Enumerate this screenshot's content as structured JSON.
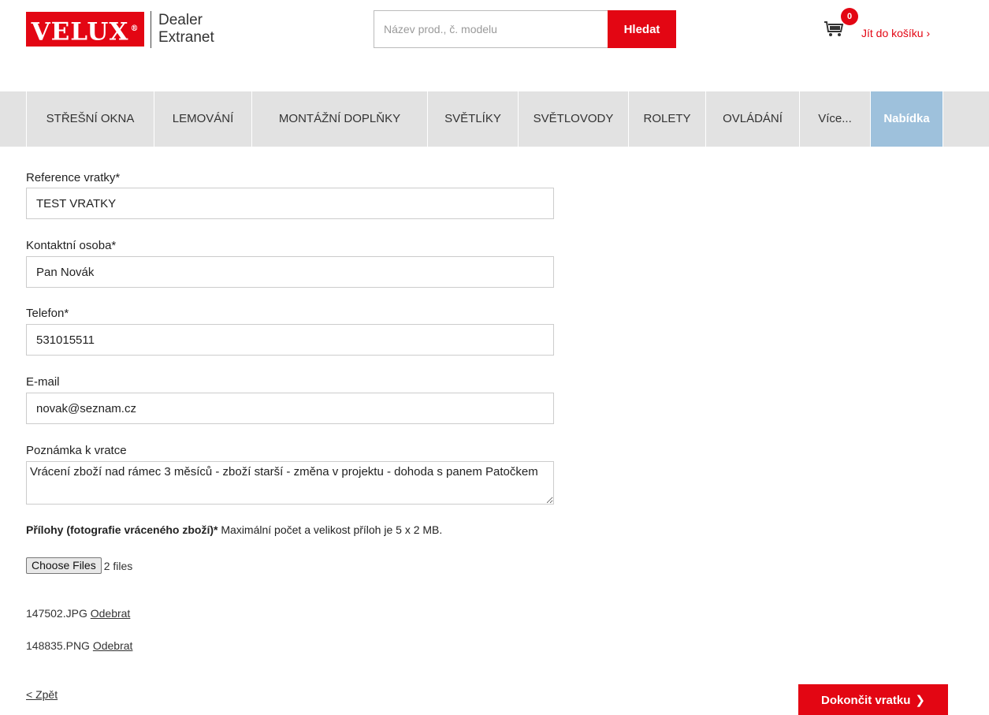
{
  "header": {
    "logo_text": "VELUX",
    "logo_mark": "®",
    "sub_line1": "Dealer",
    "sub_line2": "Extranet",
    "search_placeholder": "Název prod., č. modelu",
    "search_button": "Hledat",
    "cart_count": "0",
    "cart_link": "Jít do košíku ›",
    "cart_icon": "cart-icon"
  },
  "nav": {
    "items": [
      {
        "label": "STŘEŠNÍ OKNA"
      },
      {
        "label": "LEMOVÁNÍ"
      },
      {
        "label": "MONTÁŽNÍ DOPLŇKY"
      },
      {
        "label": "SVĚTLÍKY"
      },
      {
        "label": "SVĚTLOVODY"
      },
      {
        "label": "ROLETY"
      },
      {
        "label": "OVLÁDÁNÍ"
      },
      {
        "label": "Více..."
      },
      {
        "label": "Nabídka"
      }
    ]
  },
  "form": {
    "reference": {
      "label": "Reference vratky*",
      "value": "TEST VRATKY"
    },
    "contact": {
      "label": "Kontaktní osoba*",
      "value": "Pan Novák"
    },
    "phone": {
      "label": "Telefon*",
      "value": "531015511"
    },
    "email": {
      "label": "E-mail",
      "value": "novak@seznam.cz"
    },
    "note": {
      "label": "Poznámka k vratce",
      "value": "Vrácení zboží nad rámec 3 měsíců - zboží starší - změna v projektu - dohoda s panem Patočkem"
    },
    "attachments": {
      "label_bold": "Přílohy (fotografie vráceného zboží)*",
      "label_rest": " Maximální počet a velikost příloh je 5 x 2 MB.",
      "choose_button": "Choose Files",
      "files_count": "2 files",
      "files": [
        {
          "name": "147502.JPG",
          "remove": "Odebrat"
        },
        {
          "name": "148835.PNG",
          "remove": "Odebrat"
        }
      ]
    }
  },
  "footer": {
    "back_link": "< Zpět",
    "finish_button": "Dokončit vratku",
    "finish_chevron": "❯"
  },
  "colors": {
    "brand_red": "#e30613",
    "nav_bg": "#e2e2e2",
    "nav_active": "#9ec1dc"
  }
}
